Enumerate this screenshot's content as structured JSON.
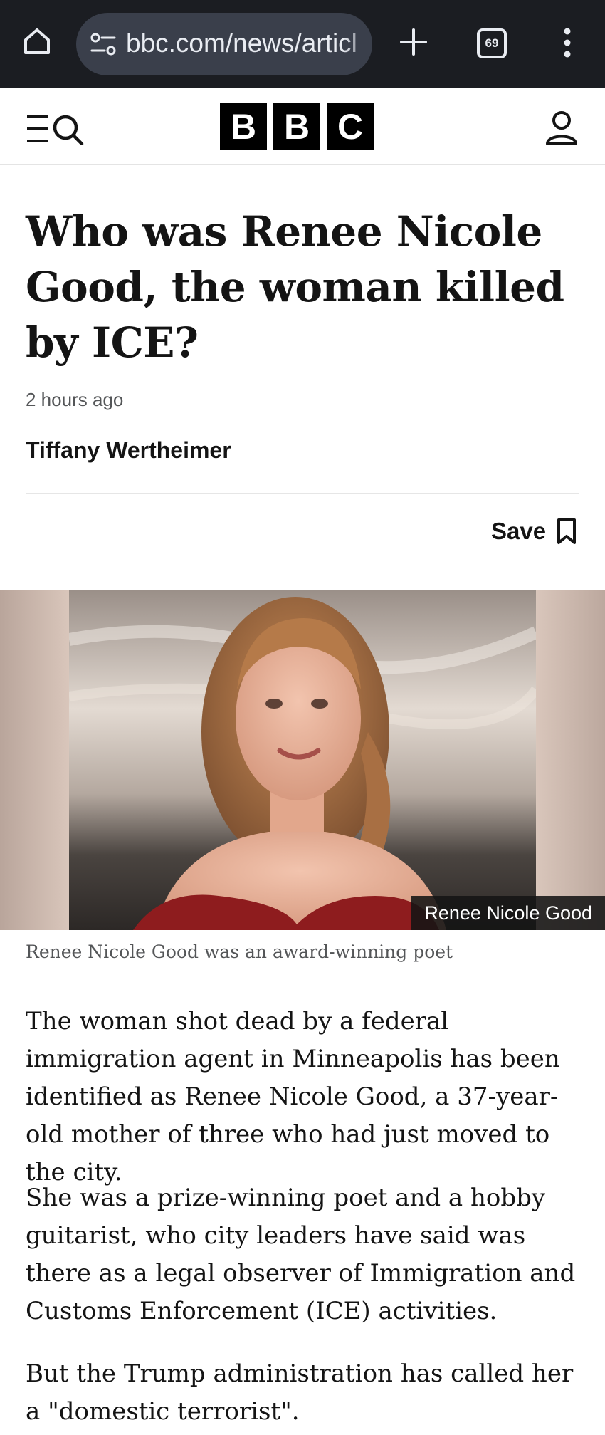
{
  "browser": {
    "url": "bbc.com/news/articl",
    "tab_count": "69",
    "icons": [
      "home-icon",
      "site-settings-icon",
      "plus-icon",
      "more-vertical-icon"
    ]
  },
  "header": {
    "logo_letters": [
      "B",
      "B",
      "C"
    ],
    "icons": [
      "menu-icon",
      "search-icon",
      "account-icon"
    ]
  },
  "article": {
    "headline": "Who was Renee Nicole Good, the woman killed by ICE?",
    "timestamp": "2 hours ago",
    "author": "Tiffany Wertheimer",
    "save_label": "Save",
    "image": {
      "credit_label": "Renee Nicole Good",
      "caption": "Renee Nicole Good was an award-winning poet"
    },
    "paragraphs": [
      "The woman shot dead by a federal immigration agent in Minneapolis has been identified as Renee Nicole Good, a 37-year-old mother of three who had just moved to the city.",
      "She was a prize-winning poet and a hobby guitarist, who city leaders have said was there as a legal observer of Immigration and Customs Enforcement (ICE) activities.",
      "But the Trump administration has called her a \"domestic terrorist\"."
    ]
  },
  "colors": {
    "browser_bar": "#1b1d22",
    "url_pill": "#3a3f4b",
    "bbc_black": "#000000",
    "text_primary": "#141414",
    "text_secondary": "#545658"
  }
}
